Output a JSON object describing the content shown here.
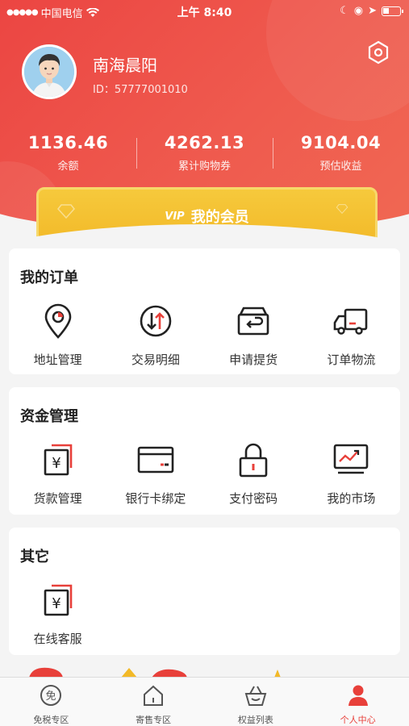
{
  "status_bar": {
    "carrier": "中国电信",
    "time": "上午 8:40"
  },
  "profile": {
    "name": "南海晨阳",
    "id_label": "ID：57777001010"
  },
  "stats": [
    {
      "value": "1136.46",
      "label": "余额"
    },
    {
      "value": "4262.13",
      "label": "累计购物券"
    },
    {
      "value": "9104.04",
      "label": "预估收益"
    }
  ],
  "vip": {
    "badge": "VIP",
    "label": "我的会员"
  },
  "orders": {
    "title": "我的订单",
    "items": [
      {
        "label": "地址管理",
        "icon": "location-pin-icon"
      },
      {
        "label": "交易明细",
        "icon": "transfer-arrows-icon"
      },
      {
        "label": "申请提货",
        "icon": "box-return-icon"
      },
      {
        "label": "订单物流",
        "icon": "truck-icon"
      }
    ]
  },
  "funds": {
    "title": "资金管理",
    "items": [
      {
        "label": "货款管理",
        "icon": "yen-card-icon"
      },
      {
        "label": "银行卡绑定",
        "icon": "bank-card-icon"
      },
      {
        "label": "支付密码",
        "icon": "lock-icon"
      },
      {
        "label": "我的市场",
        "icon": "market-chart-icon"
      }
    ]
  },
  "other": {
    "title": "其它",
    "items": [
      {
        "label": "在线客服",
        "icon": "yen-card-icon"
      }
    ]
  },
  "tabbar": [
    {
      "label": "免税专区",
      "icon": "duty-free-icon",
      "active": false
    },
    {
      "label": "寄售专区",
      "icon": "home-icon",
      "active": false
    },
    {
      "label": "权益列表",
      "icon": "basket-icon",
      "active": false
    },
    {
      "label": "个人中心",
      "icon": "person-icon",
      "active": true
    }
  ],
  "colors": {
    "primary": "#e8403a",
    "gold": "#f2b928",
    "accent_red": "#e8403a"
  }
}
